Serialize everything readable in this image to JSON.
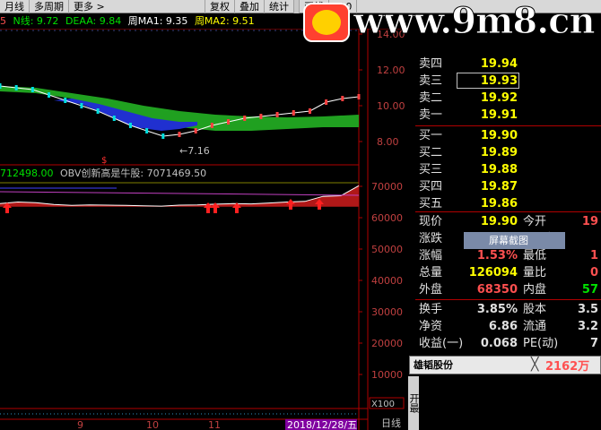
{
  "toolbar": {
    "items": [
      "月线",
      "多周期",
      "更多 >",
      "复权",
      "叠加",
      "统计",
      "画线",
      "F10"
    ]
  },
  "indicators": {
    "main_prefix": "5",
    "main": [
      {
        "label": "N线: 9.72",
        "color": "#00e000"
      },
      {
        "label": "DEAA: 9.84",
        "color": "#00e000"
      },
      {
        "label": "周MA1: 9.35",
        "color": "#ffffff"
      },
      {
        "label": "周MA2: 9.51",
        "color": "#ffff00"
      }
    ],
    "sub_value": "712498.00",
    "sub_label": "OBV创新高是牛股: 7071469.50"
  },
  "watermark": {
    "site": "www.9m8.cn"
  },
  "chart_data": [
    {
      "type": "line",
      "panel": "price",
      "y_ticks": [
        "14.00",
        "12.00",
        "10.00",
        "8.00"
      ],
      "annotations": [
        "7.16",
        "$"
      ],
      "series": [
        {
          "values": [
            11.1,
            11.0,
            10.9,
            10.6,
            10.3,
            10.0,
            9.7,
            9.3,
            8.9,
            8.6,
            8.3,
            8.4,
            8.6,
            8.9,
            9.1,
            9.3,
            9.4,
            9.5,
            9.6,
            9.7,
            10.2,
            10.4,
            10.5
          ]
        }
      ]
    },
    {
      "type": "area",
      "panel": "obv",
      "y_ticks": [
        "70000",
        "60000",
        "50000",
        "40000",
        "30000",
        "20000",
        "10000"
      ],
      "y_unit": "X100",
      "x_ticks": [
        "9",
        "10",
        "11"
      ],
      "date_label": "2018/12/28/五",
      "series": [
        {
          "values": [
            64500,
            65000,
            64800,
            64200,
            63900,
            64100,
            64000,
            63900,
            63800,
            63700,
            64000,
            64100,
            64300,
            64500,
            64400,
            64700,
            65000,
            65200,
            66800,
            67000,
            70200
          ]
        }
      ]
    }
  ],
  "quote": {
    "sell": [
      {
        "label": "卖四",
        "price": "19.94"
      },
      {
        "label": "卖三",
        "price": "19.93"
      },
      {
        "label": "卖二",
        "price": "19.92"
      },
      {
        "label": "卖一",
        "price": "19.91"
      }
    ],
    "buy": [
      {
        "label": "买一",
        "price": "19.90"
      },
      {
        "label": "买二",
        "price": "19.89"
      },
      {
        "label": "买三",
        "price": "19.88"
      },
      {
        "label": "买四",
        "price": "19.87"
      },
      {
        "label": "买五",
        "price": "19.86"
      }
    ],
    "stats": {
      "now_label": "现价",
      "now": "19.90",
      "open_label": "今开",
      "open": "19",
      "chg_label": "涨跌",
      "high_label": "最高",
      "high_val": "35",
      "pct_label": "涨幅",
      "pct": "1.53%",
      "low_label": "最低",
      "low": "1",
      "vol_label": "总量",
      "vol": "126094",
      "ratio_label": "量比",
      "ratio": "0",
      "outer_label": "外盘",
      "outer": "68350",
      "inner_label": "内盘",
      "inner": "57",
      "turn_label": "换手",
      "turn": "3.85%",
      "cap_label": "股本",
      "cap": "3.5",
      "nav_label": "净资",
      "nav": "6.86",
      "float_label": "流通",
      "float": "3.2",
      "eps_label": "收益(一)",
      "eps": "0.068",
      "pe_label": "PE(动)",
      "pe": "7"
    }
  },
  "screenshot_tip": "屏幕截图",
  "popup": {
    "title": "雄韬股份",
    "close": "╳",
    "value": "2162万"
  },
  "bottom": {
    "tabs": "开最",
    "day": "日线"
  }
}
